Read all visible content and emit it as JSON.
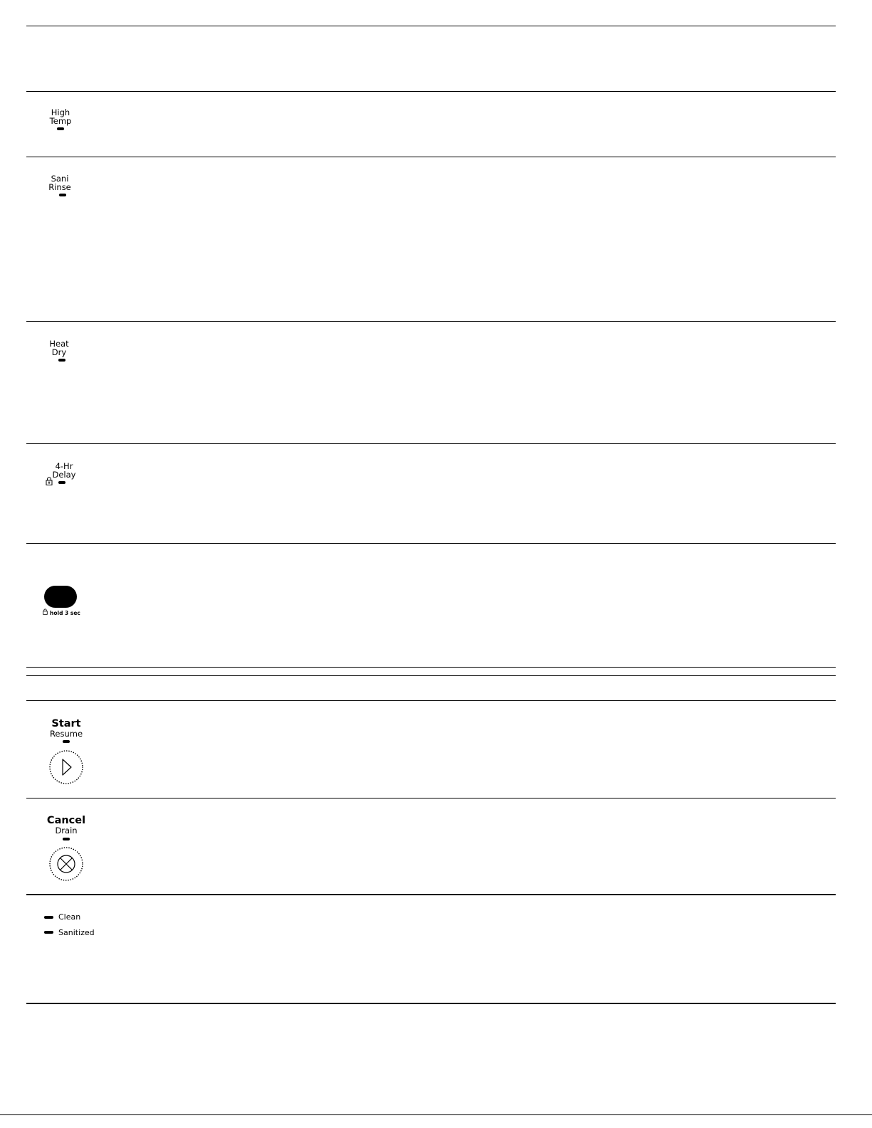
{
  "options": {
    "high_temp": {
      "line1": "High",
      "line2": "Temp"
    },
    "sani_rinse": {
      "line1": "Sani",
      "line2": "Rinse"
    },
    "heat_dry": {
      "line1": "Heat",
      "line2": "Dry"
    },
    "delay": {
      "line1": "4-Hr",
      "line2": "Delay"
    }
  },
  "control_lock": {
    "hold_text": "hold 3 sec"
  },
  "start": {
    "title": "Start",
    "subtitle": "Resume",
    "icon": "play-icon"
  },
  "cancel": {
    "title": "Cancel",
    "subtitle": "Drain",
    "icon": "close-x-icon"
  },
  "status": {
    "clean": "Clean",
    "sanitized": "Sanitized"
  }
}
